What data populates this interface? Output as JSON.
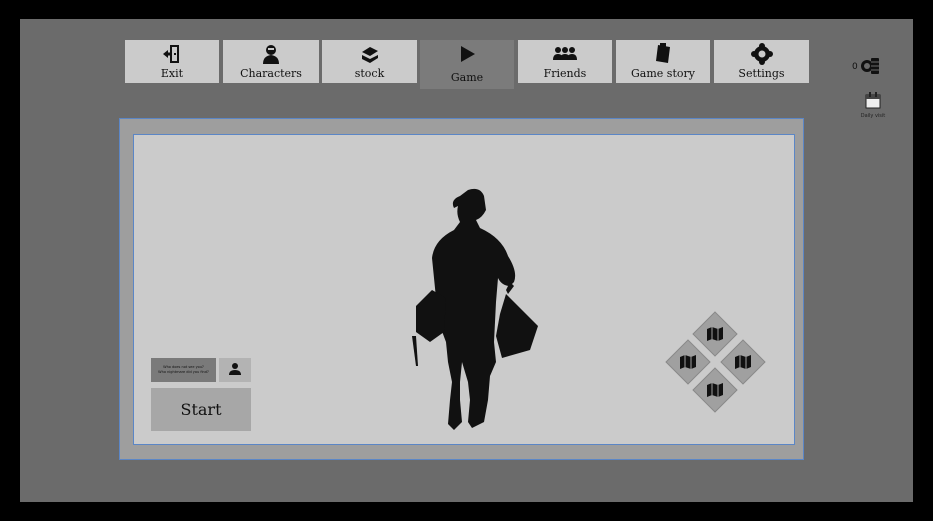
{
  "nav": {
    "tabs": [
      {
        "label": "Exit",
        "icon": "exit-door-icon"
      },
      {
        "label": "Characters",
        "icon": "character-bust-icon"
      },
      {
        "label": "stock",
        "icon": "chest-icon"
      },
      {
        "label": "Game",
        "icon": "play-icon",
        "active": true
      },
      {
        "label": "Friends",
        "icon": "friends-icon"
      },
      {
        "label": "Game story",
        "icon": "scroll-icon"
      },
      {
        "label": "Settings",
        "icon": "gear-icon"
      }
    ]
  },
  "currency": {
    "amount": "0",
    "icon": "coin-stack-icon"
  },
  "daily": {
    "label": "Daily visit",
    "icon": "calendar-icon"
  },
  "lobby": {
    "prompt_line1": "Who does not see you?",
    "prompt_line2": "Who nightmare did you find?",
    "start_label": "Start"
  },
  "colors": {
    "frame": "#6b6b6b",
    "tab": "#cbcbcb",
    "tab_active": "#7b7b7b",
    "panel_border": "#5b86c6",
    "panel_inner": "#cbcbcb",
    "panel_outer": "#9e9e9e"
  }
}
